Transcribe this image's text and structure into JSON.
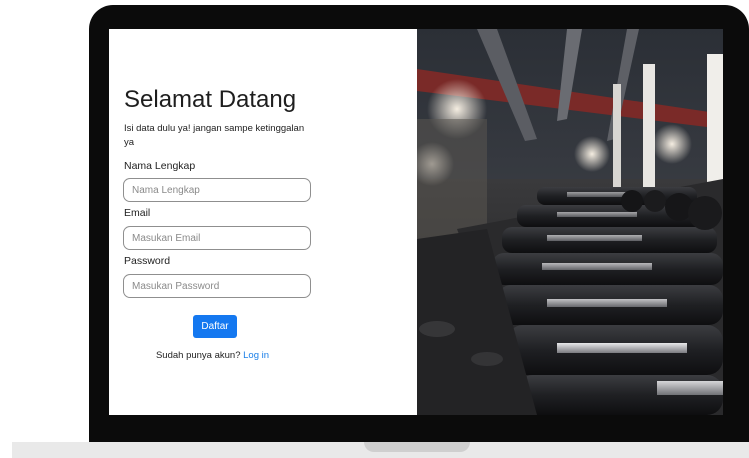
{
  "form": {
    "title": "Selamat Datang",
    "subtitle": "Isi data dulu ya! jangan sampe ketinggalan ya",
    "fields": [
      {
        "label": "Nama Lengkap",
        "placeholder": "Nama Lengkap"
      },
      {
        "label": "Email",
        "placeholder": "Masukan Email"
      },
      {
        "label": "Password",
        "placeholder": "Masukan Password"
      }
    ],
    "submit_label": "Daftar",
    "signin_prompt": "Sudah punya akun?",
    "signin_link": "Log in"
  },
  "colors": {
    "accent": "#1478f0",
    "link": "#1a7fe8",
    "bezel": "#0b0b0b"
  }
}
